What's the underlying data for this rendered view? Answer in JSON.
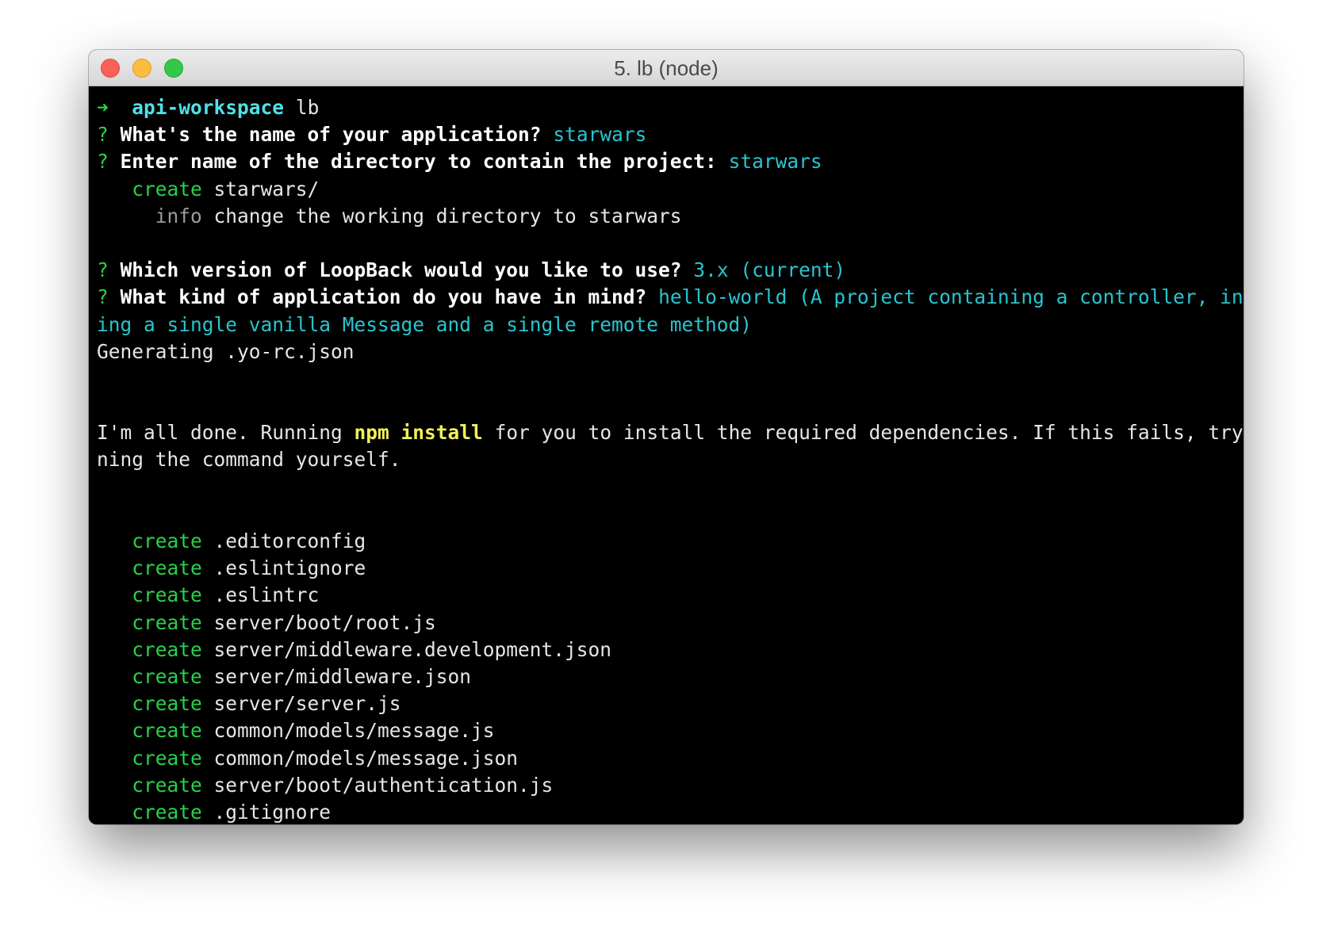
{
  "window": {
    "title": "5. lb (node)"
  },
  "terminal": {
    "prompt": {
      "arrow": "➜",
      "directory": "api-workspace",
      "command": "lb"
    },
    "q1": {
      "mark": "?",
      "question": "What's the name of your application?",
      "answer": "starwars"
    },
    "q2": {
      "mark": "?",
      "question": "Enter name of the directory to contain the project:",
      "answer": "starwars"
    },
    "create_dir": {
      "action": "create",
      "path": "starwars/"
    },
    "info": {
      "label": "info",
      "text": "change the working directory to starwars"
    },
    "q3": {
      "mark": "?",
      "question": "Which version of LoopBack would you like to use?",
      "answer": "3.x (current)"
    },
    "q4": {
      "mark": "?",
      "question": "What kind of application do you have in mind?",
      "answer_line1": "hello-world (A project containing a controller, includ",
      "answer_line2": "ing a single vanilla Message and a single remote method)"
    },
    "generating": "Generating .yo-rc.json",
    "done": {
      "prefix": "I'm all done. Running",
      "command": "npm install",
      "suffix": "for you to install the required dependencies. If this fails, try run",
      "line2": "ning the command yourself."
    },
    "created_files": [
      {
        "action": "create",
        "path": ".editorconfig"
      },
      {
        "action": "create",
        "path": ".eslintignore"
      },
      {
        "action": "create",
        "path": ".eslintrc"
      },
      {
        "action": "create",
        "path": "server/boot/root.js"
      },
      {
        "action": "create",
        "path": "server/middleware.development.json"
      },
      {
        "action": "create",
        "path": "server/middleware.json"
      },
      {
        "action": "create",
        "path": "server/server.js"
      },
      {
        "action": "create",
        "path": "common/models/message.js"
      },
      {
        "action": "create",
        "path": "common/models/message.json"
      },
      {
        "action": "create",
        "path": "server/boot/authentication.js"
      },
      {
        "action": "create",
        "path": ".gitignore"
      }
    ]
  },
  "colors": {
    "green": "#29d14a",
    "cyan": "#28c5cf",
    "gray": "#9a9a9a",
    "yellow": "#f2f05a",
    "background": "#000000"
  }
}
